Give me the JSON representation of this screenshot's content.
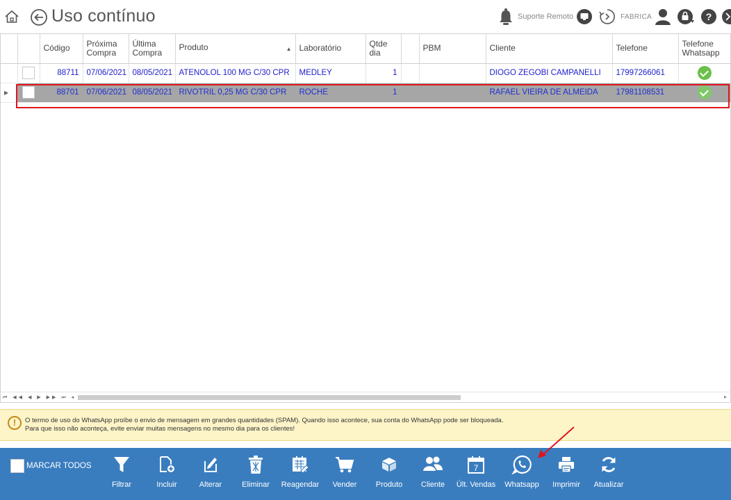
{
  "header": {
    "title": "Uso contínuo",
    "support_label": "Suporte Remoto",
    "user_label": "FABRICA"
  },
  "grid": {
    "columns": {
      "codigo": "Código",
      "proxima": "Próxima Compra",
      "ultima": "Última Compra",
      "produto": "Produto",
      "laboratorio": "Laboratório",
      "qtde": "Qtde dia",
      "pbm": "PBM",
      "cliente": "Cliente",
      "telefone": "Telefone",
      "whatsapp": "Telefone Whatsapp"
    },
    "rows": [
      {
        "codigo": "88711",
        "proxima": "07/06/2021",
        "ultima": "08/05/2021",
        "produto": "ATENOLOL 100 MG C/30 CPR",
        "laboratorio": "MEDLEY",
        "qtde": "1",
        "pbm": "",
        "cliente": "DIOGO ZEGOBI CAMPANELLI",
        "telefone": "17997266061"
      },
      {
        "codigo": "88701",
        "proxima": "07/06/2021",
        "ultima": "08/05/2021",
        "produto": "RIVOTRIL 0,25 MG C/30 CPR",
        "laboratorio": "ROCHE",
        "qtde": "1",
        "pbm": "",
        "cliente": "RAFAEL VIEIRA DE ALMEIDA",
        "telefone": "17981108531"
      }
    ]
  },
  "warning": {
    "line1": "O termo de uso do WhatsApp proíbe o envio de mensagem em grandes quantidades (SPAM). Quando isso acontece, sua conta do WhatsApp pode ser bloqueada.",
    "line2": "Para que isso não aconteça, evite enviar muitas mensagens no mesmo dia para os clientes!"
  },
  "toolbar": {
    "mark_all": "MARCAR TODOS",
    "filtrar": "Filtrar",
    "incluir": "Incluir",
    "alterar": "Alterar",
    "eliminar": "Eliminar",
    "reagendar": "Reagendar",
    "vender": "Vender",
    "produto": "Produto",
    "cliente": "Cliente",
    "ult_vendas": "Últ. Vendas",
    "calendar_day": "7",
    "whatsapp": "Whatsapp",
    "imprimir": "Imprimir",
    "atualizar": "Atualizar"
  },
  "colors": {
    "toolbar_bg": "#3a7dbf",
    "warning_bg": "#fdf4c8",
    "selection_outline": "#e0151c",
    "link_text": "#2020cc",
    "whatsapp_ok": "#6cc04a"
  }
}
